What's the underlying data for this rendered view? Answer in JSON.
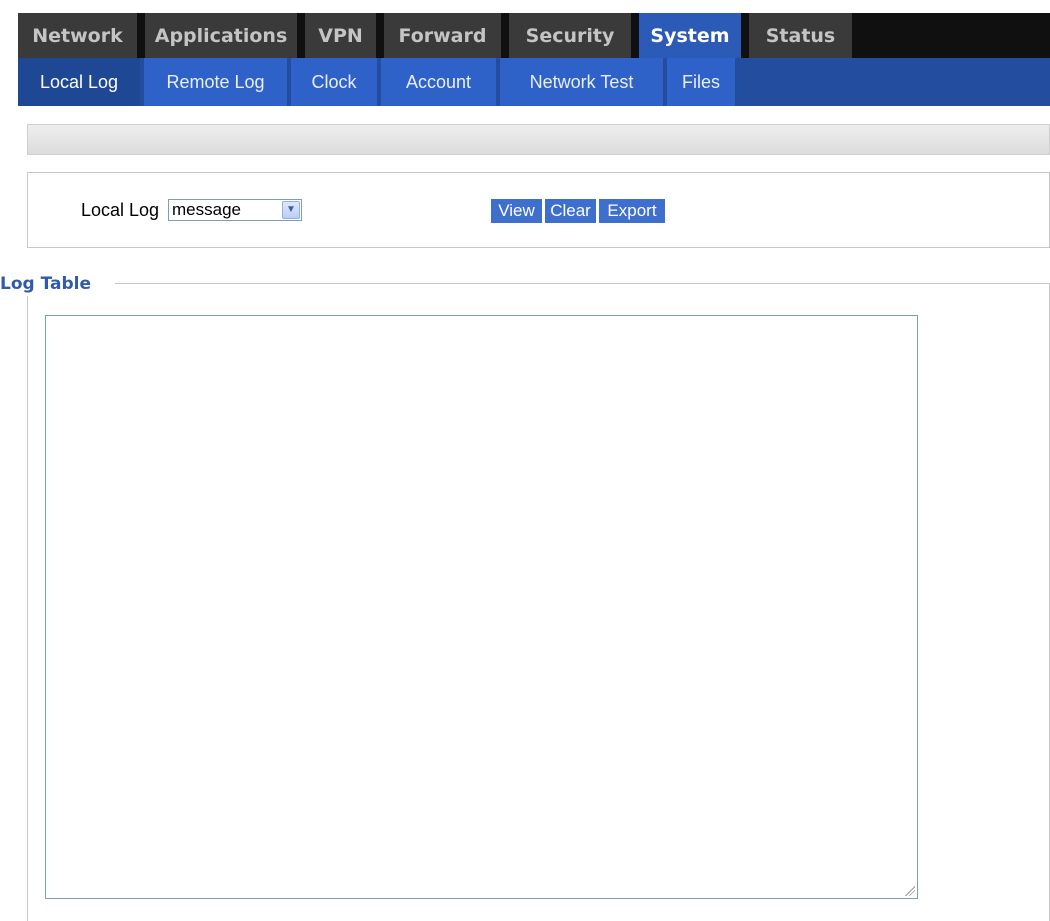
{
  "top_tabs": [
    {
      "label": "Network"
    },
    {
      "label": "Applications"
    },
    {
      "label": "VPN"
    },
    {
      "label": "Forward"
    },
    {
      "label": "Security"
    },
    {
      "label": "System"
    },
    {
      "label": "Status"
    }
  ],
  "top_tabs_active": "System",
  "sub_tabs": [
    {
      "label": "Local Log"
    },
    {
      "label": "Remote Log"
    },
    {
      "label": "Clock"
    },
    {
      "label": "Account"
    },
    {
      "label": "Network Test"
    },
    {
      "label": "Files"
    }
  ],
  "sub_tabs_active": "Local Log",
  "controls": {
    "label": "Local Log",
    "select_value": "message",
    "view_label": "View",
    "clear_label": "Clear",
    "export_label": "Export"
  },
  "log_table": {
    "legend": "Log Table",
    "content": ""
  },
  "colors": {
    "active_tab": "#2b5bb6",
    "sub_nav": "#2e62c8",
    "legend": "#2f5ba8",
    "button": "#3f6fcd"
  }
}
